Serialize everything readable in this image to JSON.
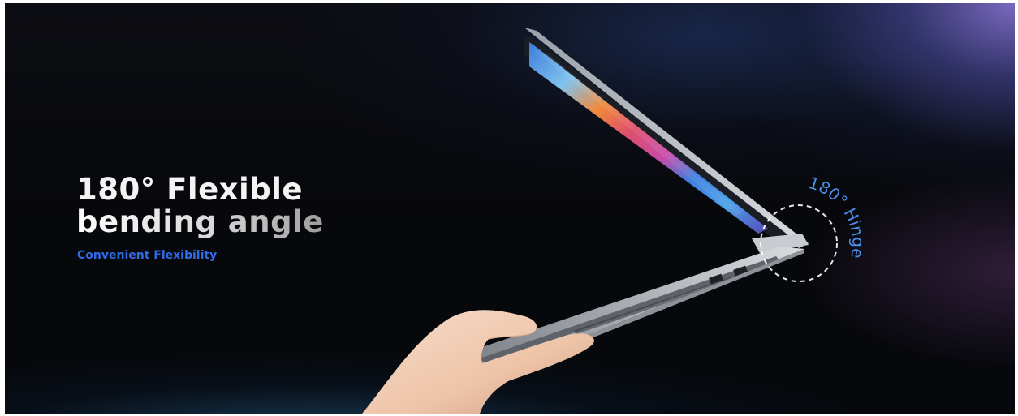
{
  "hero": {
    "headline_line1": "180° Flexible",
    "headline_line2": "bending angle",
    "subheadline": "Convenient Flexibility",
    "hinge_callout": "180° Hinge"
  },
  "colors": {
    "background": "#07080b",
    "headline": "#f2f2f2",
    "subheadline_accent": "#2f6be6",
    "hinge_callout": "#4a8fe8",
    "glow": "#806ec8"
  },
  "imagery": {
    "product": "laptop-opened-flat",
    "hand": "hand-holding-laptop",
    "hinge_marker": "dashed-circle"
  }
}
